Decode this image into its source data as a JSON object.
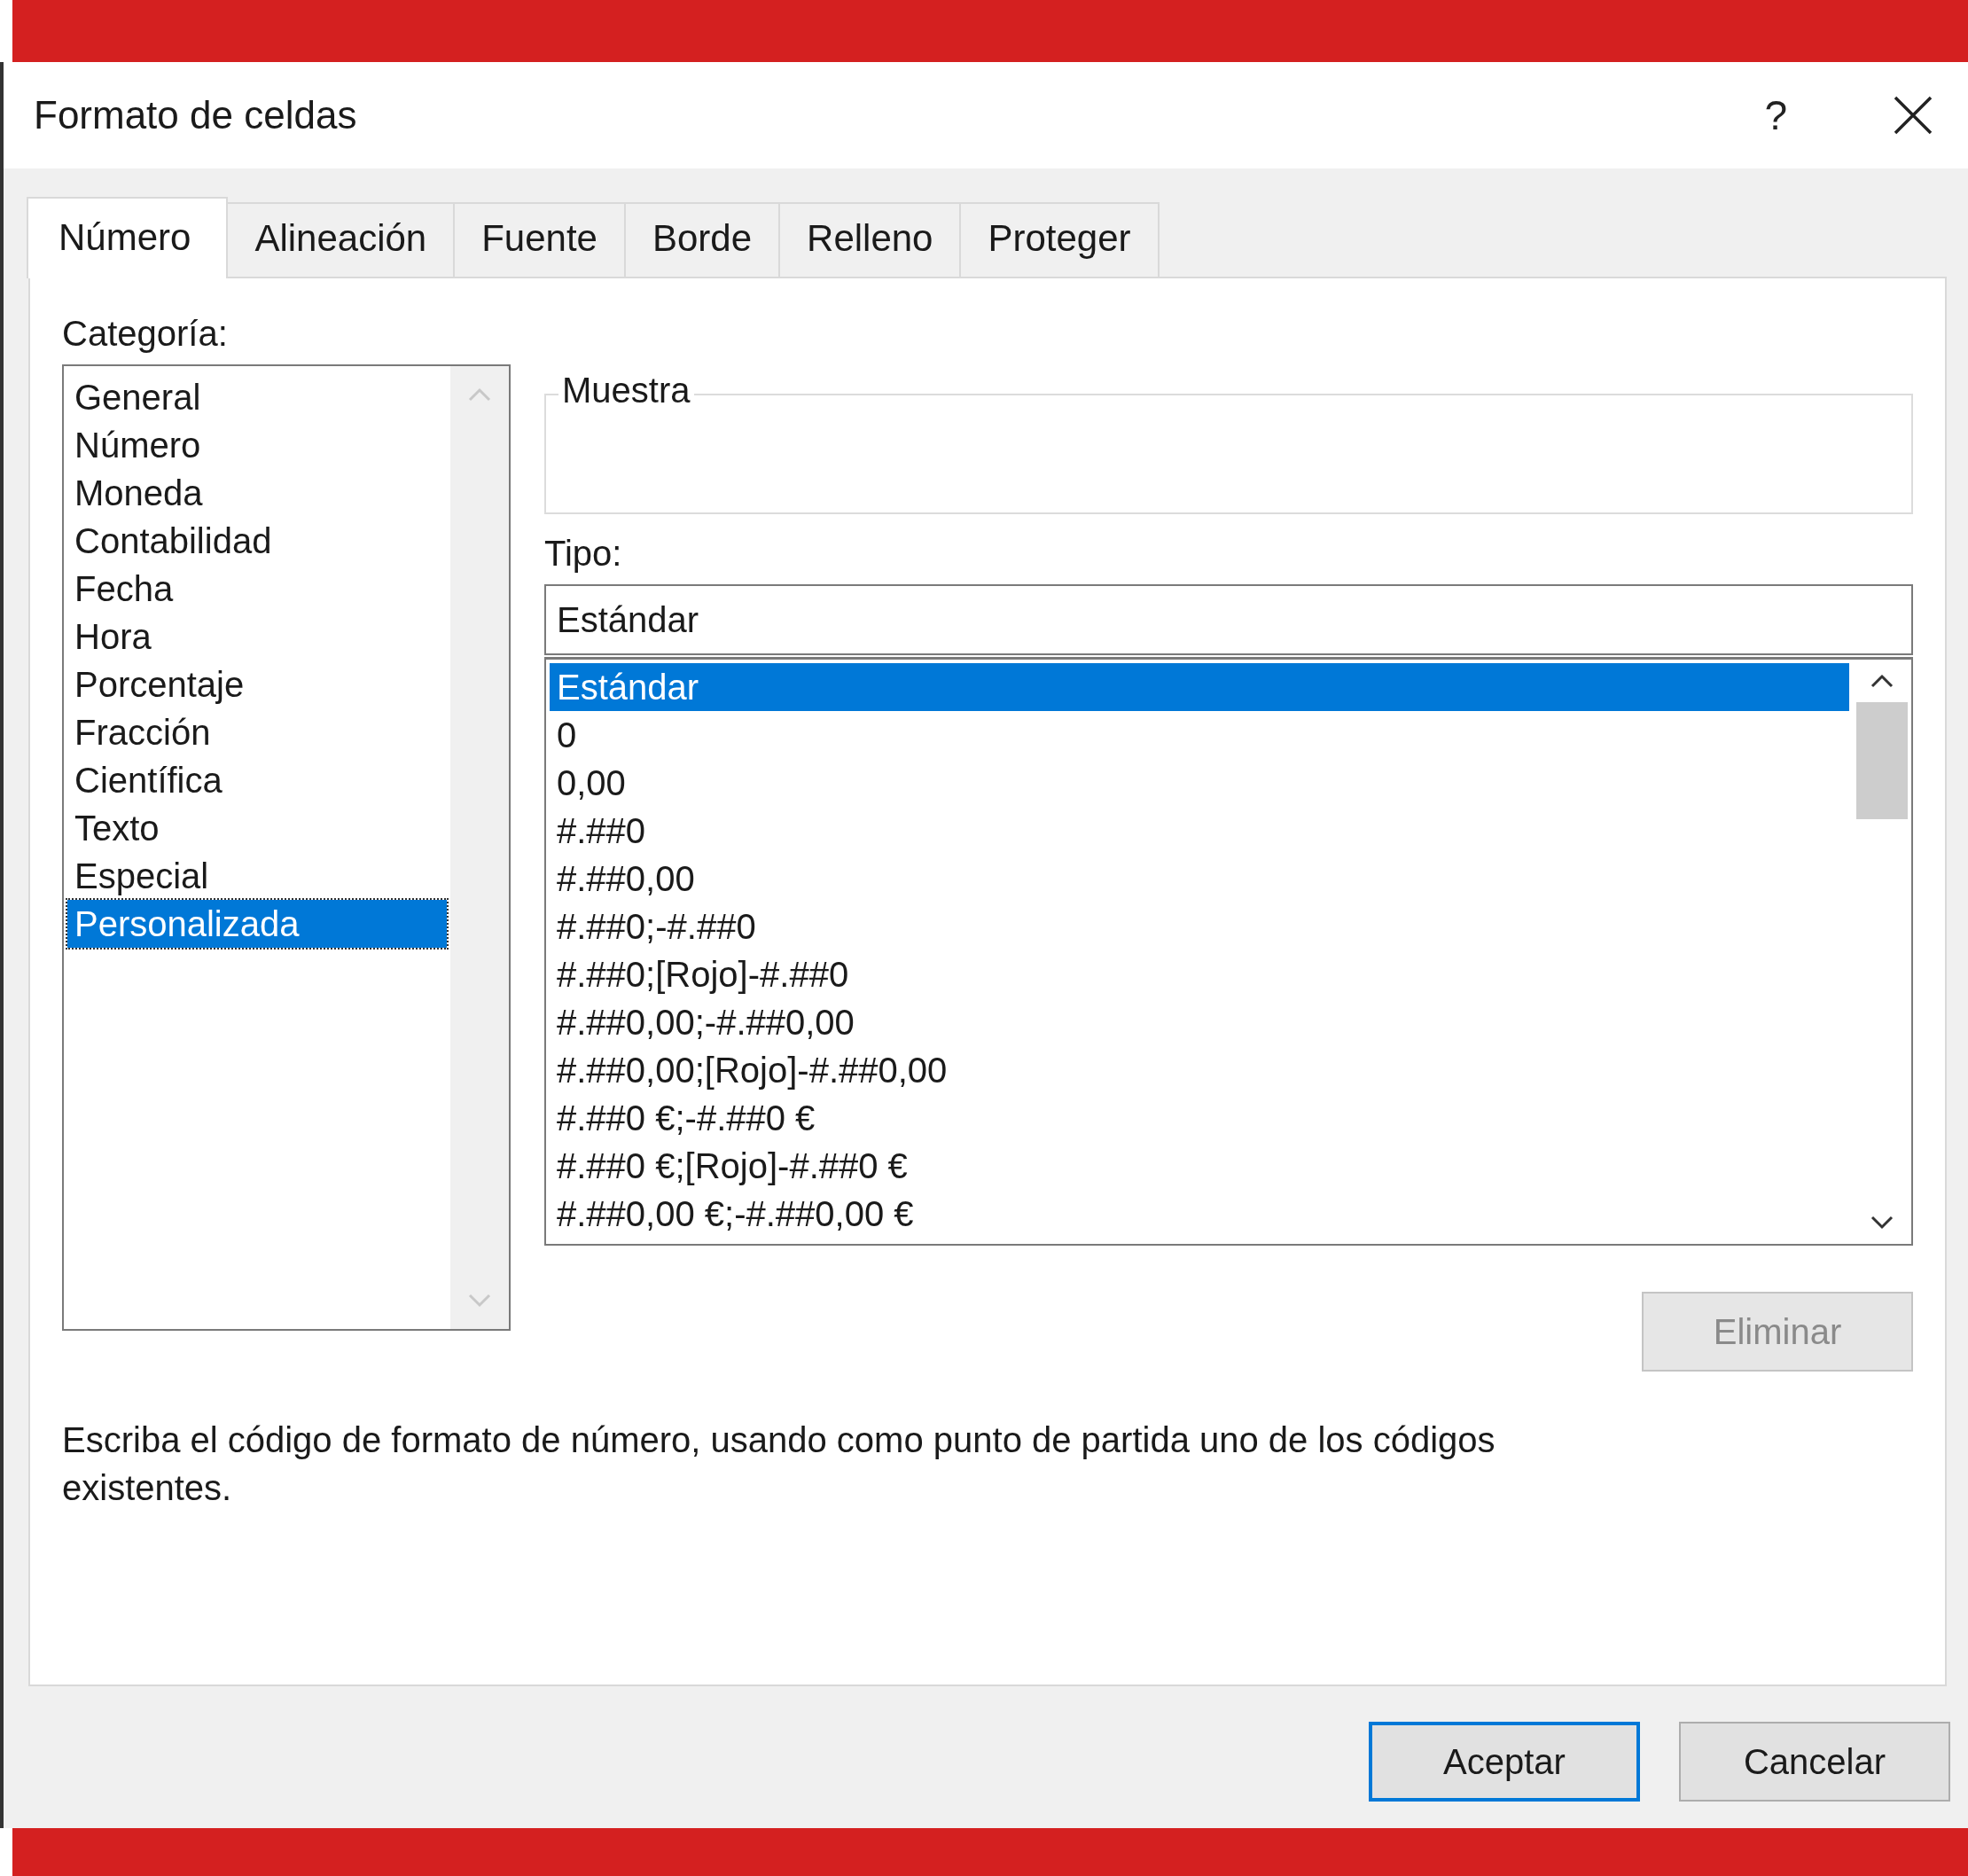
{
  "window": {
    "title": "Formato de celdas",
    "help": "?"
  },
  "tabs": [
    {
      "label": "Número",
      "selected": true
    },
    {
      "label": "Alineación",
      "selected": false
    },
    {
      "label": "Fuente",
      "selected": false
    },
    {
      "label": "Borde",
      "selected": false
    },
    {
      "label": "Relleno",
      "selected": false
    },
    {
      "label": "Proteger",
      "selected": false
    }
  ],
  "category": {
    "label": "Categoría:",
    "items": [
      {
        "label": "General",
        "selected": false
      },
      {
        "label": "Número",
        "selected": false
      },
      {
        "label": "Moneda",
        "selected": false
      },
      {
        "label": "Contabilidad",
        "selected": false
      },
      {
        "label": "Fecha",
        "selected": false
      },
      {
        "label": "Hora",
        "selected": false
      },
      {
        "label": "Porcentaje",
        "selected": false
      },
      {
        "label": "Fracción",
        "selected": false
      },
      {
        "label": "Científica",
        "selected": false
      },
      {
        "label": "Texto",
        "selected": false
      },
      {
        "label": "Especial",
        "selected": false
      },
      {
        "label": "Personalizada",
        "selected": true
      }
    ]
  },
  "sample": {
    "legend": "Muestra"
  },
  "type": {
    "label": "Tipo:",
    "value": "Estándar",
    "items": [
      {
        "label": "Estándar",
        "selected": true
      },
      {
        "label": "0",
        "selected": false
      },
      {
        "label": "0,00",
        "selected": false
      },
      {
        "label": "#.##0",
        "selected": false
      },
      {
        "label": "#.##0,00",
        "selected": false
      },
      {
        "label": "#.##0;-#.##0",
        "selected": false
      },
      {
        "label": "#.##0;[Rojo]-#.##0",
        "selected": false
      },
      {
        "label": "#.##0,00;-#.##0,00",
        "selected": false
      },
      {
        "label": "#.##0,00;[Rojo]-#.##0,00",
        "selected": false
      },
      {
        "label": "#.##0 €;-#.##0 €",
        "selected": false
      },
      {
        "label": "#.##0 €;[Rojo]-#.##0 €",
        "selected": false
      },
      {
        "label": "#.##0,00 €;-#.##0,00 €",
        "selected": false
      }
    ]
  },
  "delete_button": {
    "label": "Eliminar",
    "disabled": true
  },
  "description": "Escriba el código de formato de número, usando como punto de partida uno de los códigos existentes.",
  "buttons": [
    {
      "label": "Aceptar",
      "default": true
    },
    {
      "label": "Cancelar",
      "default": false
    }
  ]
}
